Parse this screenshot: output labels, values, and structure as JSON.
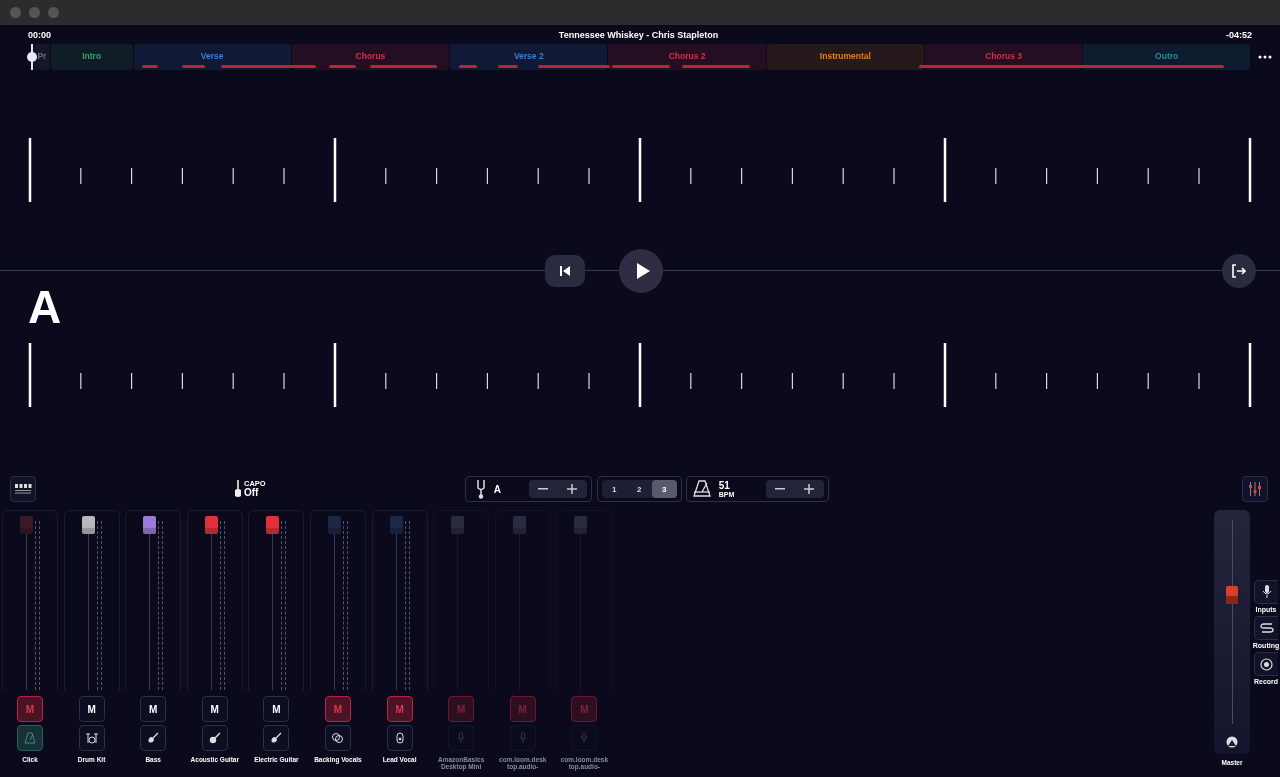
{
  "header": {
    "start_time": "00:00",
    "title": "Tennessee Whiskey - Chris Stapleton",
    "remaining_time": "-04:52"
  },
  "sections": [
    {
      "label": "Pr",
      "color": "#6a6a80"
    },
    {
      "label": "Intro",
      "color": "#3aa070"
    },
    {
      "label": "Verse",
      "color": "#3a7ed8"
    },
    {
      "label": "Chorus",
      "color": "#d0304a"
    },
    {
      "label": "Verse 2",
      "color": "#3a7ed8"
    },
    {
      "label": "Chorus 2",
      "color": "#d0304a"
    },
    {
      "label": "Instrumental",
      "color": "#e0801a"
    },
    {
      "label": "Chorus 3",
      "color": "#d0304a"
    },
    {
      "label": "Outro",
      "color": "#2a8a9a"
    }
  ],
  "chord": "A",
  "toolbar": {
    "capo_label": "CAPO",
    "capo_value": "Off",
    "tuning": "A",
    "tempo": "51",
    "tempo_unit": "BPM",
    "count_in": [
      {
        "label": "1",
        "selected": false
      },
      {
        "label": "2",
        "selected": false
      },
      {
        "label": "3",
        "selected": true
      }
    ]
  },
  "channels": [
    {
      "name": "Click",
      "mute_label": "M",
      "kind": "metronome",
      "color": "#3a1a26",
      "muted": true,
      "disabled": false,
      "level": 1
    },
    {
      "name": "Drum Kit",
      "mute_label": "M",
      "kind": "drums",
      "color": "#b8b8bc",
      "muted": false,
      "disabled": false,
      "level": 1
    },
    {
      "name": "Bass",
      "mute_label": "M",
      "kind": "bass",
      "color": "#9a7ad8",
      "muted": false,
      "disabled": false,
      "level": 1
    },
    {
      "name": "Acoustic Guitar",
      "mute_label": "M",
      "kind": "acoustic",
      "color": "#e0303c",
      "muted": false,
      "disabled": false,
      "level": 1
    },
    {
      "name": "Electric Guitar",
      "mute_label": "M",
      "kind": "electric",
      "color": "#e0303c",
      "muted": false,
      "disabled": false,
      "level": 1
    },
    {
      "name": "Backing Vocals",
      "mute_label": "M",
      "kind": "vocals",
      "color": "#1c2848",
      "muted": true,
      "disabled": false,
      "level": 1
    },
    {
      "name": "Lead Vocal",
      "mute_label": "M",
      "kind": "mic",
      "color": "#1c2848",
      "muted": true,
      "disabled": false,
      "level": 1
    },
    {
      "name": "AmazonBasics Desktop Mini",
      "mute_label": "M",
      "kind": "input",
      "color": "#2a2a40",
      "muted": true,
      "disabled": true,
      "level": 1
    },
    {
      "name": "com.loom.desk top.audio-",
      "mute_label": "M",
      "kind": "input",
      "color": "#2a2a40",
      "muted": true,
      "disabled": true,
      "level": 1
    },
    {
      "name": "com.loom.desk top.audio-",
      "mute_label": "M",
      "kind": "input",
      "color": "#2a2a40",
      "muted": true,
      "disabled": true,
      "level": 1
    }
  ],
  "master": {
    "name": "Master",
    "level": 0.63
  },
  "side_buttons": [
    {
      "label": "Inputs",
      "kind": "mic"
    },
    {
      "label": "Routing",
      "kind": "routing"
    },
    {
      "label": "Record",
      "kind": "record"
    }
  ]
}
